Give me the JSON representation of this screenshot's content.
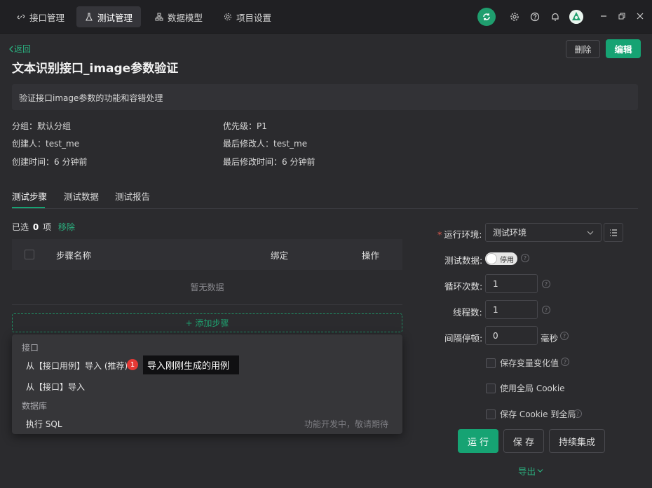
{
  "nav": {
    "tabs": [
      {
        "label": "接口管理",
        "icon": "link-icon"
      },
      {
        "label": "测试管理",
        "icon": "flask-icon"
      },
      {
        "label": "数据模型",
        "icon": "model-icon"
      },
      {
        "label": "项目设置",
        "icon": "gear-icon"
      }
    ]
  },
  "header": {
    "back_label": "返回",
    "title": "文本识别接口_image参数验证",
    "delete_label": "删除",
    "edit_label": "编辑"
  },
  "description": "验证接口image参数的功能和容错处理",
  "meta": {
    "group_key": "分组：",
    "group_val": "默认分组",
    "creator_key": "创建人：",
    "creator_val": "test_me",
    "created_key": "创建时间：",
    "created_val": "6 分钟前",
    "priority_key": "优先级：",
    "priority_val": "P1",
    "modifier_key": "最后修改人：",
    "modifier_val": "test_me",
    "modified_key": "最后修改时间：",
    "modified_val": "6 分钟前"
  },
  "tabs": [
    "测试步骤",
    "测试数据",
    "测试报告"
  ],
  "selection": {
    "prefix": "已选",
    "count": "0",
    "suffix": "项",
    "remove_label": "移除"
  },
  "table": {
    "headers": [
      "步骤名称",
      "绑定",
      "操作"
    ],
    "empty_text": "暂无数据"
  },
  "add_step_label": "+ 添加步骤",
  "dropdown": {
    "group1": "接口",
    "item1": "从【接口用例】导入 (推荐)",
    "item2": "从【接口】导入",
    "group2": "数据库",
    "item3": "执行 SQL",
    "item3_note": "功能开发中，敬请期待",
    "badge": "1",
    "tooltip": "导入刚刚生成的用例"
  },
  "form": {
    "env_label": "运行环境:",
    "env_value": "测试环境",
    "test_data_label": "测试数据:",
    "switch_label": "停用",
    "loop_label": "循环次数:",
    "loop_value": "1",
    "threads_label": "线程数:",
    "threads_value": "1",
    "interval_label": "间隔停顿:",
    "interval_value": "0",
    "interval_unit": "毫秒",
    "opt1": "保存变量变化值",
    "opt2": "使用全局 Cookie",
    "opt3": "保存 Cookie 到全局"
  },
  "actions": {
    "run": "运行",
    "save": "保 存",
    "ci": "持续集成",
    "export": "导出"
  },
  "colors": {
    "accent": "#16a373",
    "background": "#2b2b2e",
    "topbar": "#202023",
    "badge": "#e53935"
  }
}
